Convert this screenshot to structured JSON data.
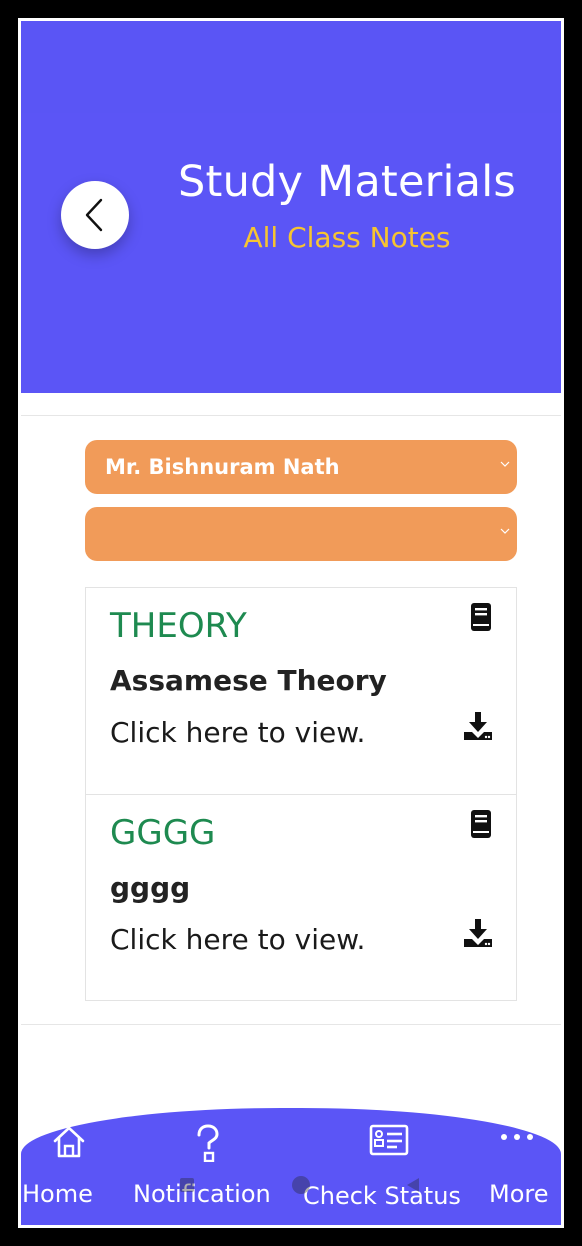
{
  "header": {
    "title": "Study Materials",
    "subtitle": "All Class Notes"
  },
  "filters": {
    "teacher_selected": "Mr. Bishnuram Nath",
    "second_selected": ""
  },
  "materials": [
    {
      "type": "THEORY",
      "title": "Assamese Theory",
      "link_text": "Click here to view."
    },
    {
      "type": "GGGG",
      "title": "gggg",
      "link_text": "Click here to view."
    }
  ],
  "bottom_nav": {
    "items": [
      {
        "label": "Home",
        "icon": "home-icon"
      },
      {
        "label": "Notification",
        "icon": "question-icon"
      },
      {
        "label": "Check Status",
        "icon": "checklist-icon"
      },
      {
        "label": "More",
        "icon": "more-dots-icon"
      }
    ]
  },
  "colors": {
    "header_bg": "#5b55f6",
    "accent_orange": "#f19b59",
    "subtitle_yellow": "#f6c431",
    "type_green": "#1e8a50"
  }
}
